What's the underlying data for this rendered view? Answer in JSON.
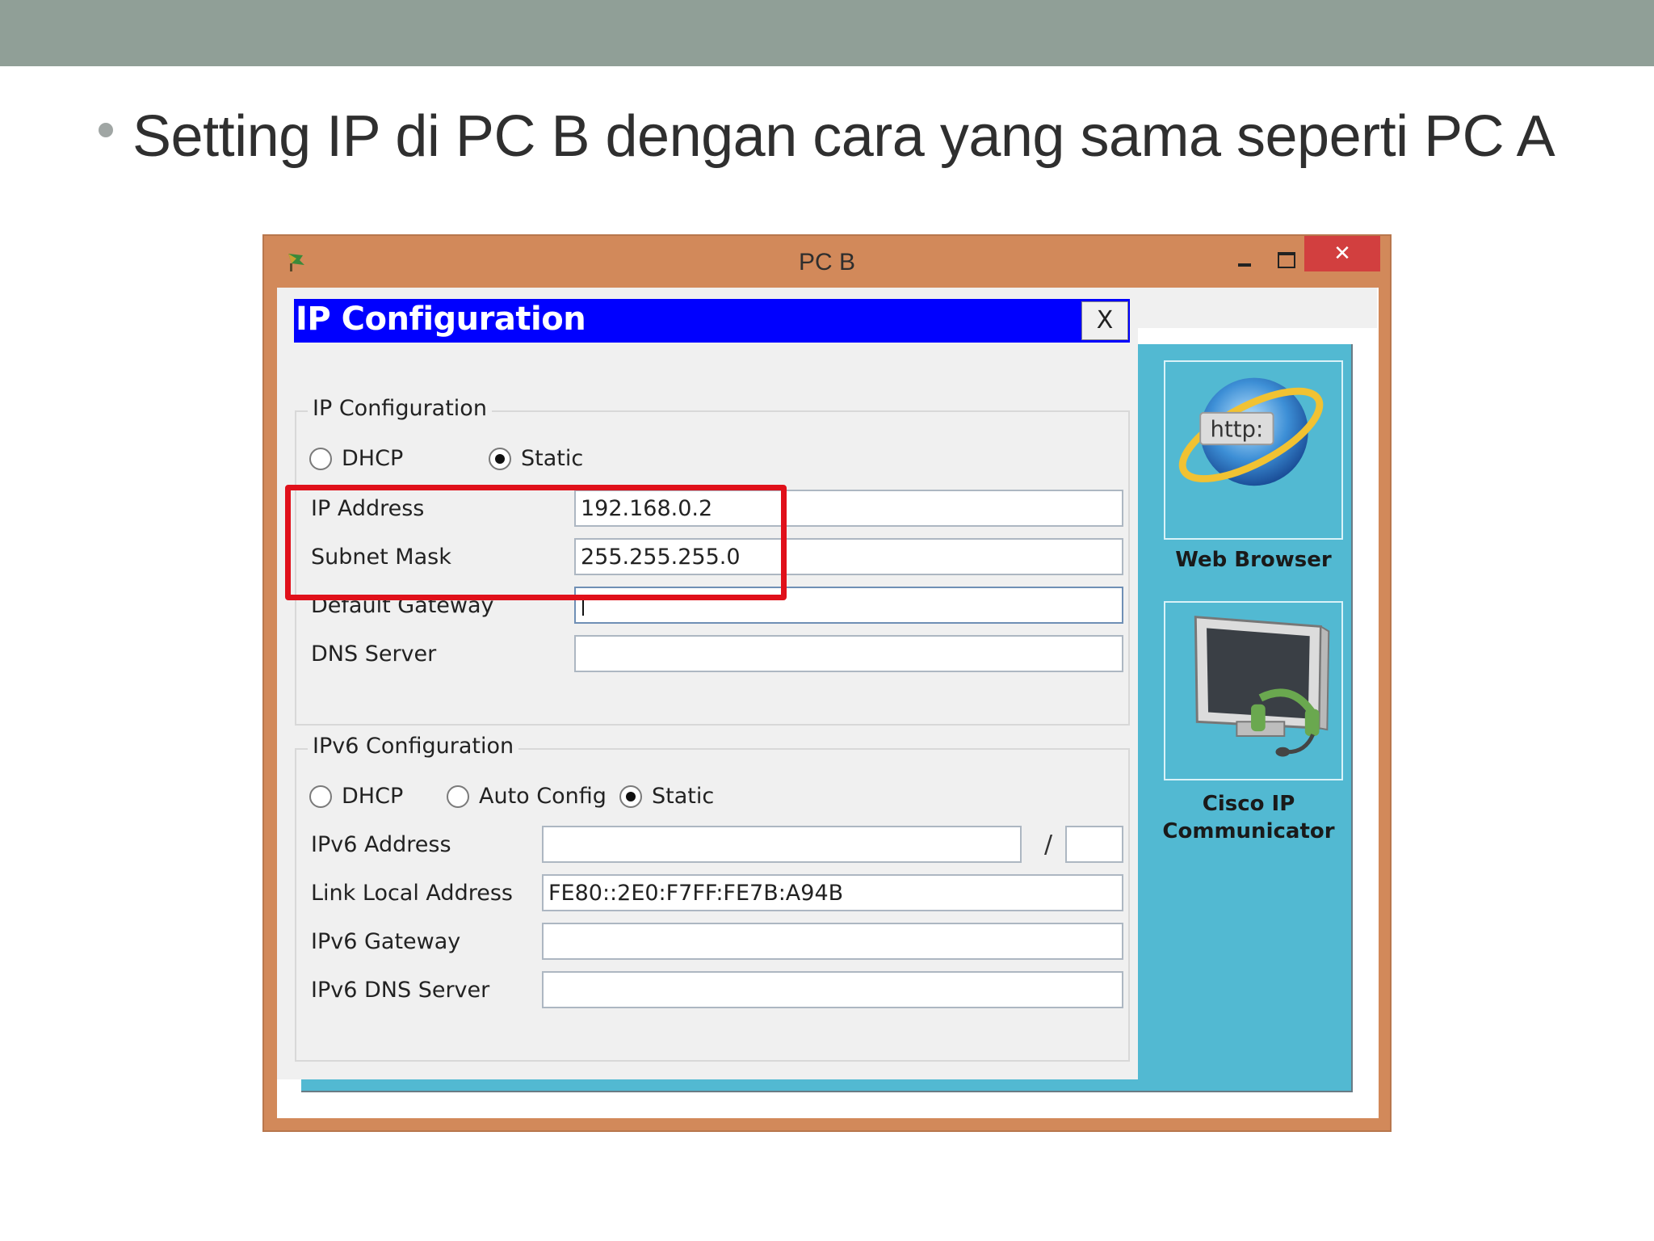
{
  "slide": {
    "title": "Setting IP di PC B dengan cara yang sama seperti PC A"
  },
  "window": {
    "title": "PC B",
    "minimize_glyph": "–",
    "maximize_glyph": "□",
    "close_glyph": "✕"
  },
  "dialog": {
    "title": "IP Configuration",
    "close_label": "X",
    "ipv4": {
      "legend": "IP Configuration",
      "mode_options": [
        "DHCP",
        "Static"
      ],
      "selected_mode": "Static",
      "fields": {
        "ip_address": {
          "label": "IP Address",
          "value": "192.168.0.2"
        },
        "subnet_mask": {
          "label": "Subnet Mask",
          "value": "255.255.255.0"
        },
        "default_gateway": {
          "label": "Default Gateway",
          "value": ""
        },
        "dns_server": {
          "label": "DNS Server",
          "value": ""
        }
      }
    },
    "ipv6": {
      "legend": "IPv6 Configuration",
      "mode_options": [
        "DHCP",
        "Auto Config",
        "Static"
      ],
      "selected_mode": "Static",
      "fields": {
        "ipv6_address": {
          "label": "IPv6 Address",
          "value": "",
          "prefix": ""
        },
        "link_local_address": {
          "label": "Link Local Address",
          "value": "FE80::2E0:F7FF:FE7B:A94B"
        },
        "ipv6_gateway": {
          "label": "IPv6 Gateway",
          "value": ""
        },
        "ipv6_dns_server": {
          "label": "IPv6 DNS Server",
          "value": ""
        }
      },
      "prefix_separator": "/"
    }
  },
  "apps": {
    "web_browser": {
      "label": "Web Browser",
      "icon_text": "http:",
      "icon": "web-browser-icon"
    },
    "cisco_ip_communicator": {
      "label_line1": "Cisco IP",
      "label_line2": "Communicator",
      "icon": "monitor-headset-icon"
    }
  },
  "colors": {
    "window_frame": "#d2895a",
    "close_button": "#d23f3f",
    "dialog_titlebar": "#0000ff",
    "desktop_panel": "#52b9d2",
    "highlight_box": "#e0101a",
    "slide_top_bar": "#909f97"
  }
}
